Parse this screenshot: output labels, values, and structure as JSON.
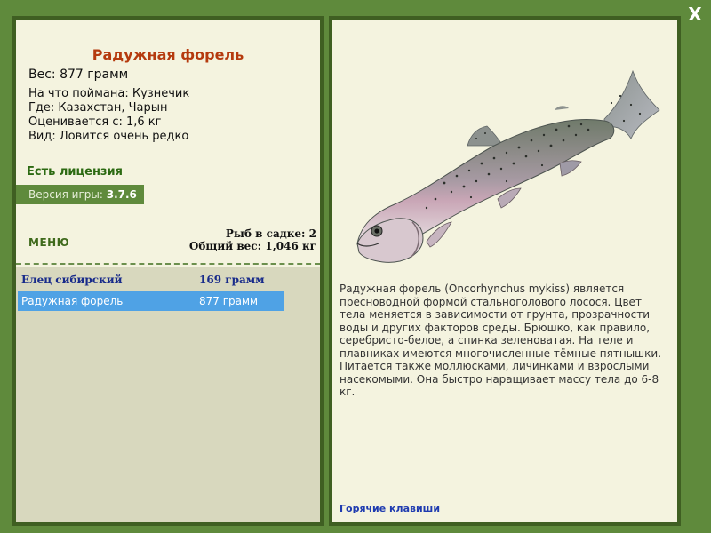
{
  "close_label": "X",
  "fish": {
    "title": "Радужная форель",
    "weight": "Вес: 877 грамм",
    "caught_with": "На что поймана: Кузнечик",
    "location": "Где: Казахстан, Чарын",
    "valued_at": "Оценивается с: 1,6 кг",
    "rarity": "Вид: Ловится очень редко"
  },
  "license": "Есть лицензия",
  "version": {
    "label": "Версия игры:",
    "value": "3.7.6"
  },
  "menu_label": "МЕНЮ",
  "stats": {
    "count": "Рыб в садке: 2",
    "total_weight": "Общий вес: 1,046 кг"
  },
  "catch_list": [
    {
      "name": "Елец сибирский",
      "weight": "169 грамм"
    },
    {
      "name": "Радужная форель",
      "weight": "877 грамм"
    }
  ],
  "description": "Радужная форель (Oncorhynchus mykiss) является пресноводной формой стальноголового лосося. Цвет тела меняется в зависимости от грунта, прозрачности воды и других факторов среды. Брюшко, как правило, серебристо-белое, а спинка зеленоватая. На теле и плавниках имеются многочисленные тёмные пятнышки. Питается также моллюсками, личинками и взрослыми насекомыми. Она быстро наращивает массу тела до 6-8 кг.",
  "hotkeys_label": "Горячие клавиши",
  "colors": {
    "frame": "#5f8a3c",
    "panel": "#f4f3df",
    "title": "#b53a0e",
    "license": "#2c6a12",
    "selected_row": "#4fa2e5",
    "link": "#1f3bb0"
  }
}
